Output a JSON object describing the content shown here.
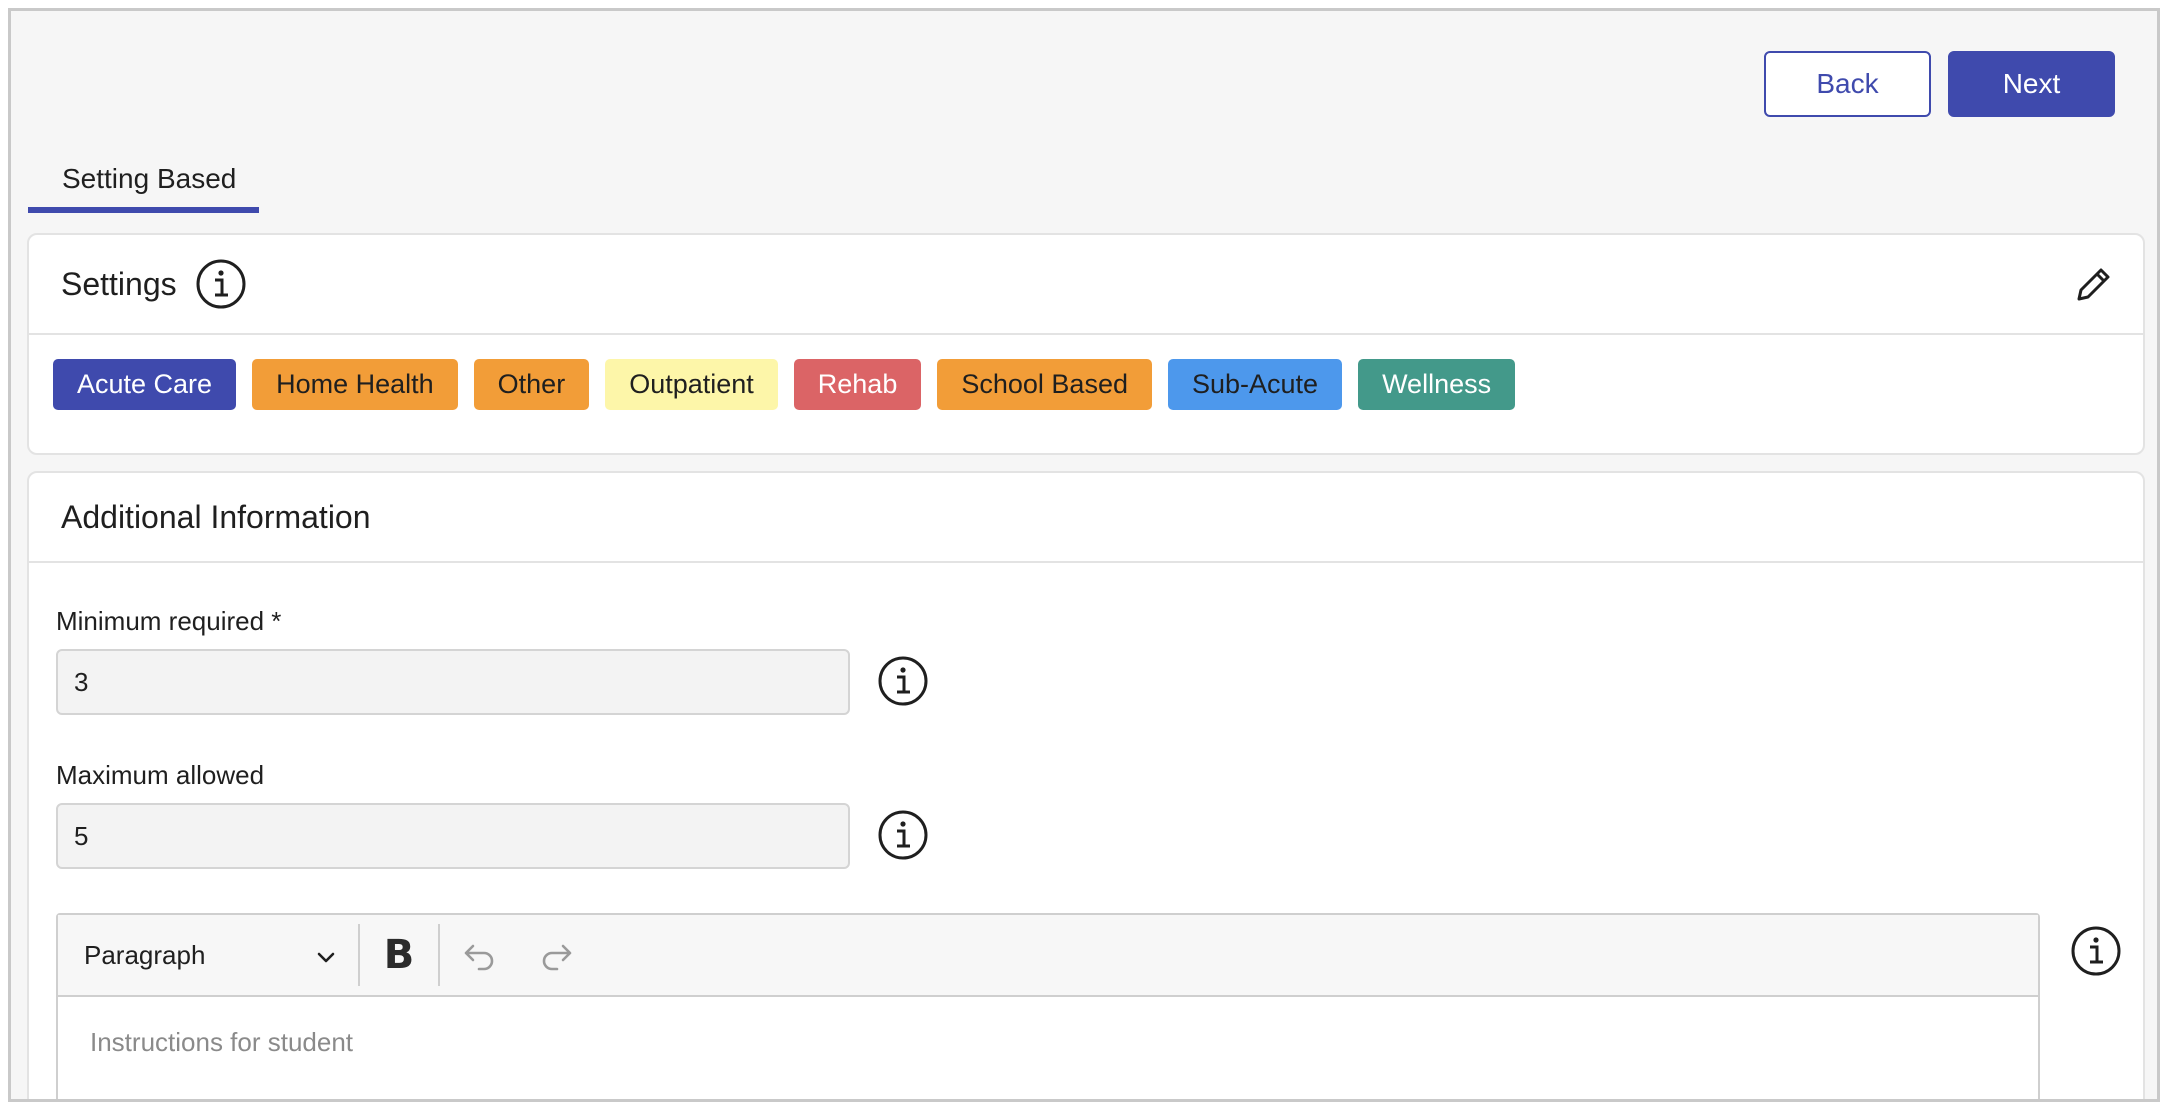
{
  "header": {
    "back_label": "Back",
    "next_label": "Next",
    "primary_color": "#3f4aad"
  },
  "tabs": [
    {
      "label": "Setting Based",
      "active": true
    }
  ],
  "settings_card": {
    "title": "Settings",
    "tags": [
      {
        "label": "Acute Care",
        "bg": "#3f4aad",
        "fg": "#ffffff"
      },
      {
        "label": "Home Health",
        "bg": "#f29d38",
        "fg": "#1f1f1f"
      },
      {
        "label": "Other",
        "bg": "#f29d38",
        "fg": "#1f1f1f"
      },
      {
        "label": "Outpatient",
        "bg": "#fdf6a9",
        "fg": "#1f1f1f"
      },
      {
        "label": "Rehab",
        "bg": "#db6466",
        "fg": "#ffffff"
      },
      {
        "label": "School Based",
        "bg": "#f29d38",
        "fg": "#1f1f1f"
      },
      {
        "label": "Sub-Acute",
        "bg": "#4d98ec",
        "fg": "#1f1f1f"
      },
      {
        "label": "Wellness",
        "bg": "#43998a",
        "fg": "#ffffff"
      }
    ]
  },
  "additional_info": {
    "title": "Additional Information",
    "minimum": {
      "label": "Minimum required *",
      "value": "3"
    },
    "maximum": {
      "label": "Maximum allowed",
      "value": "5"
    },
    "editor": {
      "block_format": "Paragraph",
      "bold_label": "B",
      "placeholder": "Instructions for student"
    }
  },
  "icons": {
    "info": "info-circle-icon",
    "edit": "pencil-icon",
    "undo": "undo-icon",
    "redo": "redo-icon",
    "dropdown": "chevron-down-icon"
  }
}
